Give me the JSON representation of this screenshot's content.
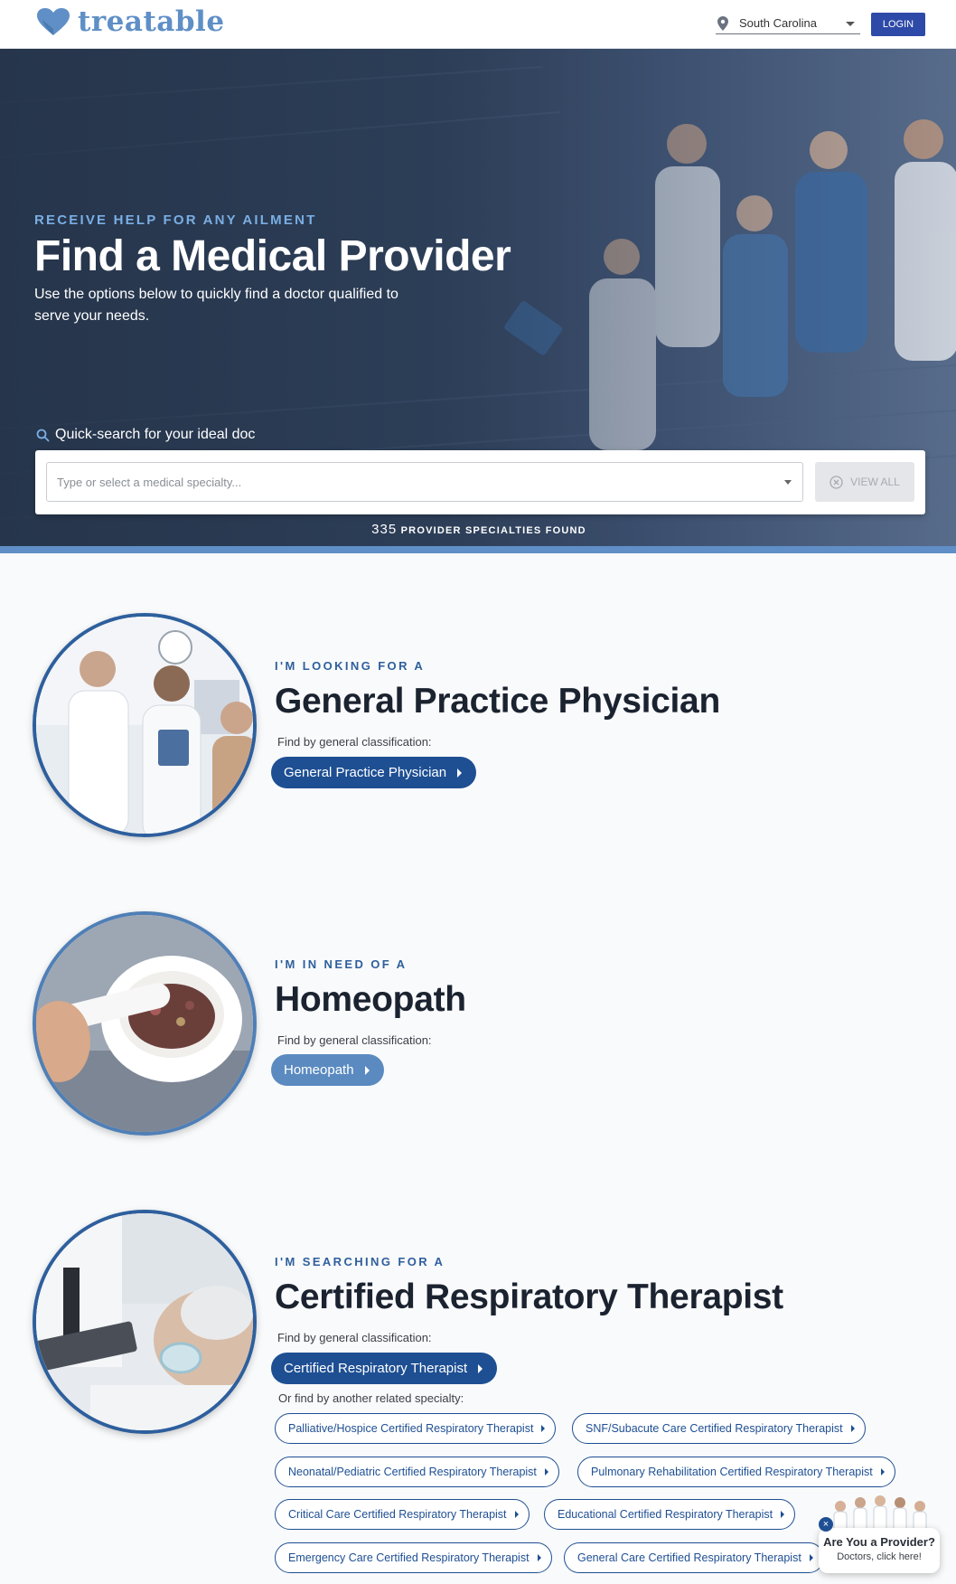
{
  "header": {
    "brand": "treatable",
    "location": "South Carolina",
    "login_label": "LOGIN"
  },
  "hero": {
    "eyebrow": "RECEIVE HELP FOR ANY AILMENT",
    "title": "Find a Medical Provider",
    "subtitle": "Use the options below to quickly find a doctor qualified to serve your needs.",
    "quick_search_label": "Quick-search for your ideal doc",
    "search_placeholder": "Type or select a medical specialty...",
    "view_all_label": "VIEW ALL",
    "found_count": "335",
    "found_text": "PROVIDER SPECIALTIES FOUND"
  },
  "sections": [
    {
      "eyebrow": "I'M LOOKING FOR A",
      "title": "General Practice Physician",
      "classification_label": "Find by general classification:",
      "button_label": "General Practice Physician"
    },
    {
      "eyebrow": "I'M IN NEED OF A",
      "title": "Homeopath",
      "classification_label": "Find by general classification:",
      "button_label": "Homeopath"
    },
    {
      "eyebrow": "I'M SEARCHING FOR A",
      "title": "Certified Respiratory Therapist",
      "classification_label": "Find by general classification:",
      "button_label": "Certified Respiratory Therapist",
      "related_label": "Or find by another related specialty:",
      "related": [
        "Palliative/Hospice Certified Respiratory Therapist",
        "SNF/Subacute Care Certified Respiratory Therapist",
        "Neonatal/Pediatric Certified Respiratory Therapist",
        "Pulmonary Rehabilitation Certified Respiratory Therapist",
        "Critical Care Certified Respiratory Therapist",
        "Educational Certified Respiratory Therapist",
        "Emergency Care Certified Respiratory Therapist",
        "General Care Certified Respiratory Therapist"
      ]
    }
  ],
  "provider_widget": {
    "title": "Are You a Provider?",
    "subtitle": "Doctors, click here!",
    "close": "×"
  },
  "colors": {
    "brand": "#5f8fc6",
    "primary": "#1e4f93",
    "login": "#2e4aa8",
    "hero_eyebrow": "#7aaee4"
  }
}
